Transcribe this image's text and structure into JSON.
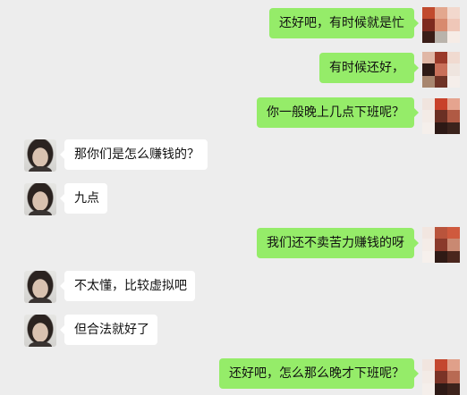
{
  "messages": [
    {
      "side": "right",
      "text": "还好吧，有时候就是忙"
    },
    {
      "side": "right",
      "text": "有时候还好，"
    },
    {
      "side": "right",
      "text": "你一般晚上几点下班呢？"
    },
    {
      "side": "left",
      "text": "那你们是怎么赚钱的？"
    },
    {
      "side": "left",
      "text": "九点"
    },
    {
      "side": "right",
      "text": "我们还不卖苦力赚钱的呀"
    },
    {
      "side": "left",
      "text": "不太懂，比较虚拟吧"
    },
    {
      "side": "left",
      "text": "但合法就好了"
    },
    {
      "side": "right",
      "text": "还好吧，怎么那么晚才下班呢？"
    }
  ],
  "colors": {
    "background": "#ededed",
    "sent_bubble": "#95ec69",
    "received_bubble": "#ffffff"
  }
}
